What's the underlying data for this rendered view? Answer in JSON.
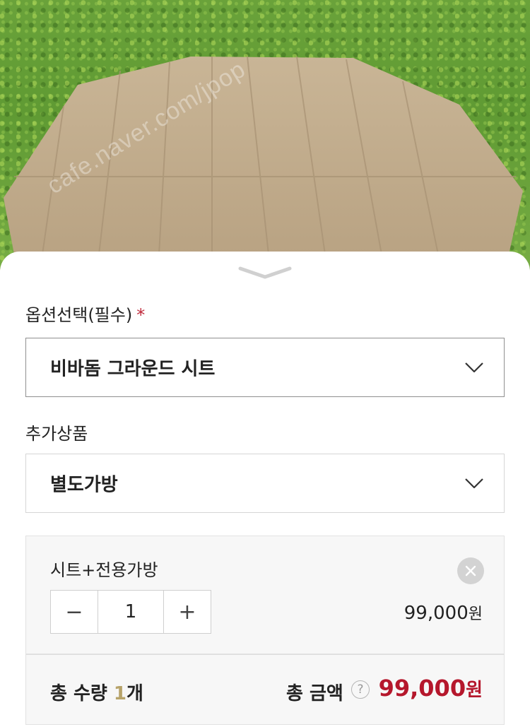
{
  "photo": {
    "watermark": "cafe.naver.com/jpop"
  },
  "options": {
    "required_label": "옵션선택(필수)",
    "required_mark": "*",
    "selected_option": "비바돔 그라운드 시트",
    "addon_label": "추가상품",
    "selected_addon": "별도가방"
  },
  "item": {
    "name": "시트+전용가방",
    "quantity": "1",
    "price": "99,000",
    "currency": "원",
    "minus": "−",
    "plus": "+"
  },
  "totals": {
    "quantity_prefix": "총 수량 ",
    "quantity_value": "1",
    "quantity_unit": "개",
    "amount_label": "총 금액",
    "help": "?",
    "amount_value": "99,000",
    "currency": "원"
  },
  "colors": {
    "accent_red": "#b5172c",
    "required_red": "#c0283a",
    "quantity_gold": "#b7a36a"
  }
}
